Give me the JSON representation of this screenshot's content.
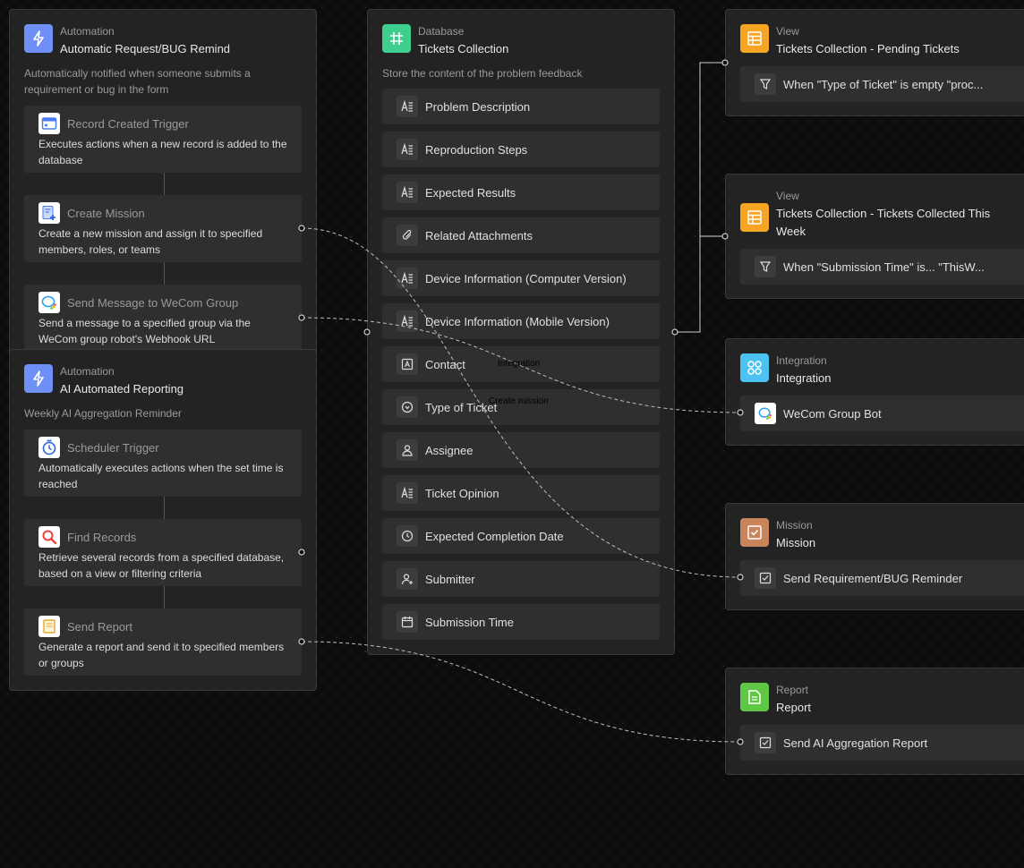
{
  "colors": {
    "automation": "#6e8ff5",
    "database": "#3ecf8e",
    "view": "#f5a524",
    "integration": "#4cc3f0",
    "mission": "#c8845a",
    "report": "#5fc744"
  },
  "automation1": {
    "type": "Automation",
    "title": "Automatic Request/BUG Remind",
    "desc": "Automatically notified when someone submits a requirement or bug in the form",
    "steps": [
      {
        "icon": "record-created-icon",
        "name": "Record Created Trigger",
        "desc": "Executes actions when a new record is added to the database"
      },
      {
        "icon": "create-mission-icon",
        "name": "Create Mission",
        "desc": "Create a new mission and assign it to specified members, roles, or teams"
      },
      {
        "icon": "wecom-icon",
        "name": "Send Message to WeCom Group",
        "desc": "Send a message to a specified group via the WeCom group robot's Webhook URL"
      }
    ]
  },
  "automation2": {
    "type": "Automation",
    "title": "AI Automated Reporting",
    "desc": "Weekly AI Aggregation Reminder",
    "steps": [
      {
        "icon": "scheduler-icon",
        "name": "Scheduler Trigger",
        "desc": "Automatically executes actions when the set time is reached"
      },
      {
        "icon": "find-records-icon",
        "name": "Find Records",
        "desc": "Retrieve several records from a specified database, based on a view or filtering criteria"
      },
      {
        "icon": "send-report-icon",
        "name": "Send Report",
        "desc": "Generate a report and send it to specified members or groups"
      }
    ]
  },
  "database": {
    "type": "Database",
    "title": "Tickets Collection",
    "desc": "Store the content of the problem feedback",
    "fields": [
      {
        "icon": "long-text-icon",
        "label": "Problem Description"
      },
      {
        "icon": "long-text-icon",
        "label": "Reproduction Steps"
      },
      {
        "icon": "long-text-icon",
        "label": "Expected Results"
      },
      {
        "icon": "paperclip-icon",
        "label": "Related Attachments"
      },
      {
        "icon": "long-text-icon",
        "label": "Device Information (Computer Version)"
      },
      {
        "icon": "long-text-icon",
        "label": "Device Information (Mobile Version)"
      },
      {
        "icon": "contact-icon",
        "label": "Contact"
      },
      {
        "icon": "single-select-icon",
        "label": "Type of Ticket"
      },
      {
        "icon": "person-icon",
        "label": "Assignee"
      },
      {
        "icon": "long-text-icon",
        "label": "Ticket Opinion"
      },
      {
        "icon": "clock-icon",
        "label": "Expected Completion Date"
      },
      {
        "icon": "person-add-icon",
        "label": "Submitter"
      },
      {
        "icon": "calendar-icon",
        "label": "Submission Time"
      }
    ]
  },
  "view1": {
    "type": "View",
    "title": "Tickets Collection - Pending Tickets",
    "filter": "When \"Type of Ticket\" is empty \"proc..."
  },
  "view2": {
    "type": "View",
    "title": "Tickets Collection - Tickets Collected This Week",
    "filter": "When \"Submission Time\" is... \"ThisW..."
  },
  "integration": {
    "type": "Integration",
    "title": "Integration",
    "item": "WeCom Group Bot"
  },
  "mission": {
    "type": "Mission",
    "title": "Mission",
    "item": "Send Requirement/BUG Reminder"
  },
  "report": {
    "type": "Report",
    "title": "Report",
    "item": "Send AI Aggregation Report"
  },
  "edge_labels": {
    "integration": "Integration",
    "create_mission": "Create mission"
  }
}
